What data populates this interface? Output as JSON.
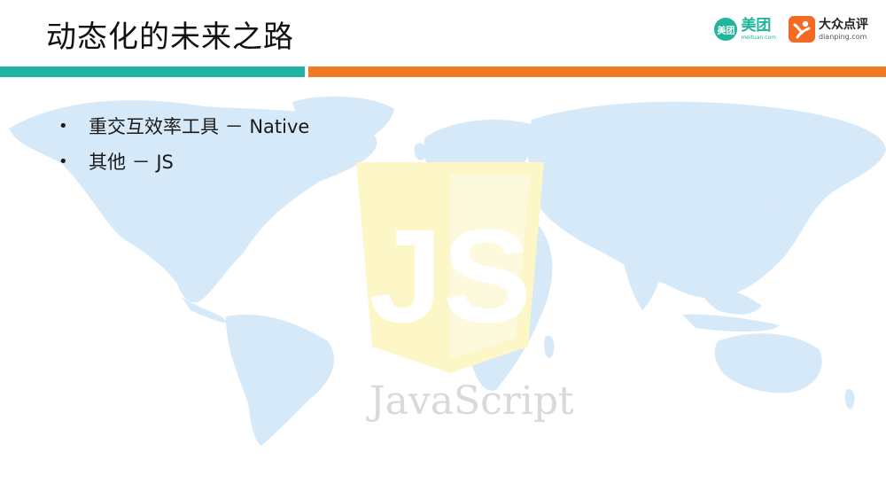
{
  "slide": {
    "title": "动态化的未来之路",
    "bullets": [
      {
        "text": "重交互效率工具 － Native"
      },
      {
        "text": "其他 －  JS"
      }
    ]
  },
  "logos": {
    "meituan": {
      "badge": "美团",
      "name": "美团",
      "domain": "meituan.com"
    },
    "dianping": {
      "name": "大众点评",
      "domain": "dianping.com"
    }
  },
  "background": {
    "js_logo_text": "JavaScript"
  },
  "colors": {
    "teal": "#23b3a5",
    "orange": "#f07a22",
    "map": "#d6e9f8",
    "js_shield": "#fdf6c7"
  }
}
